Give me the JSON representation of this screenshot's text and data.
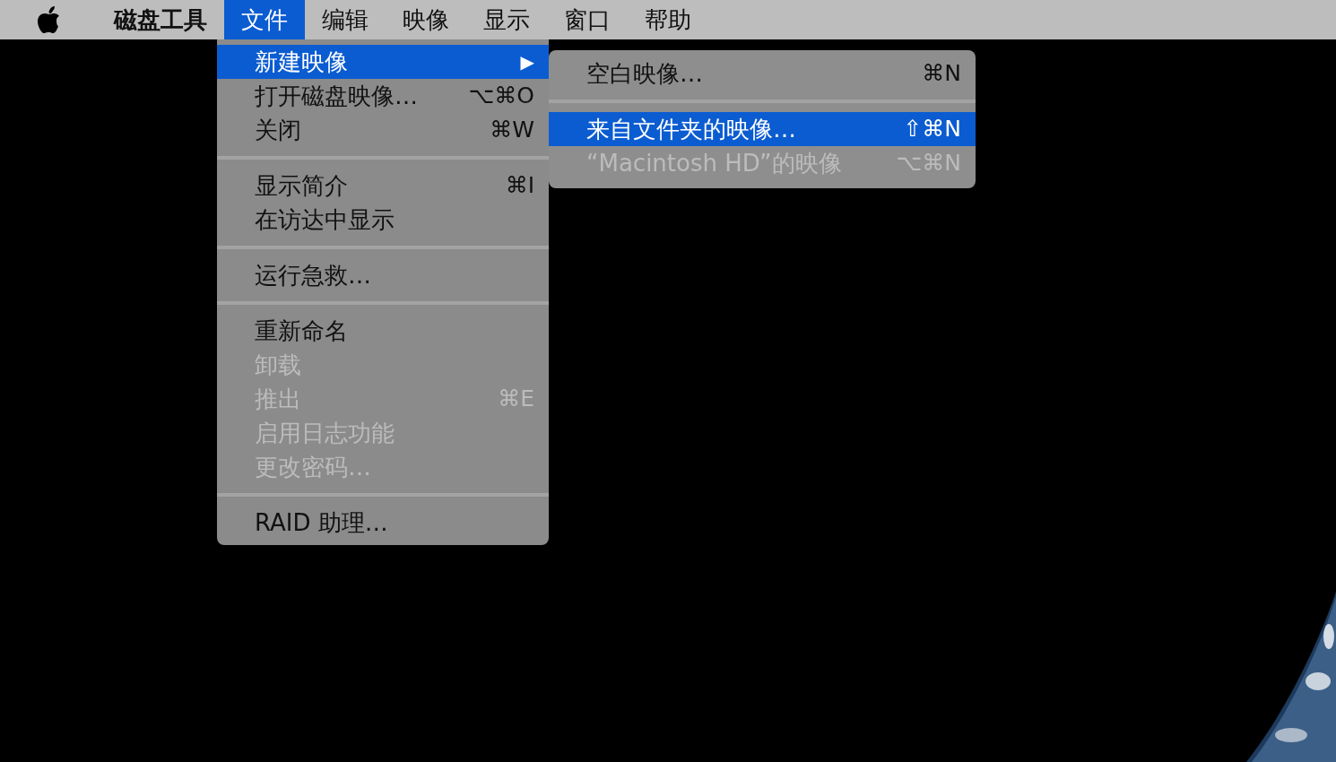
{
  "menu_bar": {
    "items": [
      {
        "kind": "app",
        "label": "磁盘工具",
        "selected": false
      },
      {
        "kind": "menu",
        "label": "文件",
        "selected": true
      },
      {
        "kind": "menu",
        "label": "编辑",
        "selected": false
      },
      {
        "kind": "menu",
        "label": "映像",
        "selected": false
      },
      {
        "kind": "menu",
        "label": "显示",
        "selected": false
      },
      {
        "kind": "menu",
        "label": "窗口",
        "selected": false
      },
      {
        "kind": "menu",
        "label": "帮助",
        "selected": false
      }
    ]
  },
  "file_menu": {
    "items": [
      {
        "kind": "item",
        "label": "新建映像",
        "submenu_arrow": "▶",
        "selected": true,
        "disabled": false
      },
      {
        "kind": "item",
        "label": "打开磁盘映像…",
        "shortcut": "⌥⌘O",
        "selected": false,
        "disabled": false
      },
      {
        "kind": "item",
        "label": "关闭",
        "shortcut": "⌘W",
        "selected": false,
        "disabled": false
      },
      {
        "kind": "separator"
      },
      {
        "kind": "item",
        "label": "显示简介",
        "shortcut": "⌘I",
        "selected": false,
        "disabled": false
      },
      {
        "kind": "item",
        "label": "在访达中显示",
        "selected": false,
        "disabled": false
      },
      {
        "kind": "separator"
      },
      {
        "kind": "item",
        "label": "运行急救…",
        "selected": false,
        "disabled": false
      },
      {
        "kind": "separator"
      },
      {
        "kind": "item",
        "label": "重新命名",
        "selected": false,
        "disabled": false
      },
      {
        "kind": "item",
        "label": "卸载",
        "selected": false,
        "disabled": true
      },
      {
        "kind": "item",
        "label": "推出",
        "shortcut": "⌘E",
        "selected": false,
        "disabled": true
      },
      {
        "kind": "item",
        "label": "启用日志功能",
        "selected": false,
        "disabled": true
      },
      {
        "kind": "item",
        "label": "更改密码…",
        "selected": false,
        "disabled": true
      },
      {
        "kind": "separator"
      },
      {
        "kind": "item",
        "label": "RAID 助理…",
        "selected": false,
        "disabled": false
      }
    ]
  },
  "submenu": {
    "items": [
      {
        "kind": "item",
        "label": "空白映像…",
        "shortcut": "⌘N",
        "selected": false,
        "disabled": false
      },
      {
        "kind": "separator"
      },
      {
        "kind": "item",
        "label": "来自文件夹的映像…",
        "shortcut": "⇧⌘N",
        "selected": true,
        "disabled": false
      },
      {
        "kind": "item",
        "label": "“Macintosh HD”的映像",
        "shortcut": "⌥⌘N",
        "selected": false,
        "disabled": true
      }
    ]
  }
}
